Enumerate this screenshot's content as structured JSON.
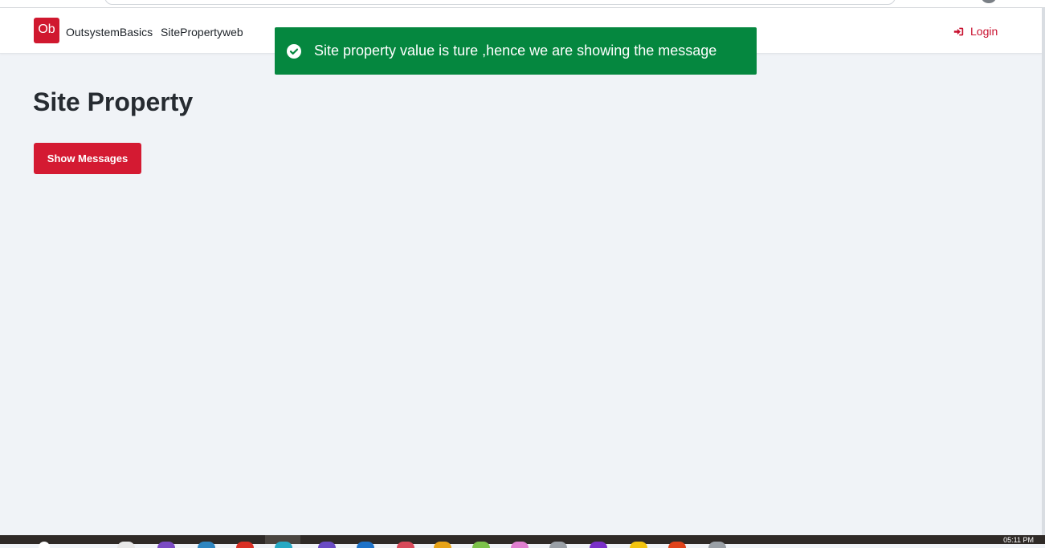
{
  "header": {
    "logo_text": "Ob",
    "app_name": "OutsystemBasics",
    "nav_link": "SitePropertyweb",
    "login_label": "Login"
  },
  "toast": {
    "message": "Site property value is ture ,hence we are showing the message",
    "color": "#05873f"
  },
  "main": {
    "title": "Site Property",
    "show_messages_button": "Show Messages",
    "button_color": "#d41a32"
  },
  "taskbar": {
    "clock": "05:11 PM"
  },
  "icons": {
    "toast": "check-circle-icon",
    "login": "sign-in-icon"
  }
}
